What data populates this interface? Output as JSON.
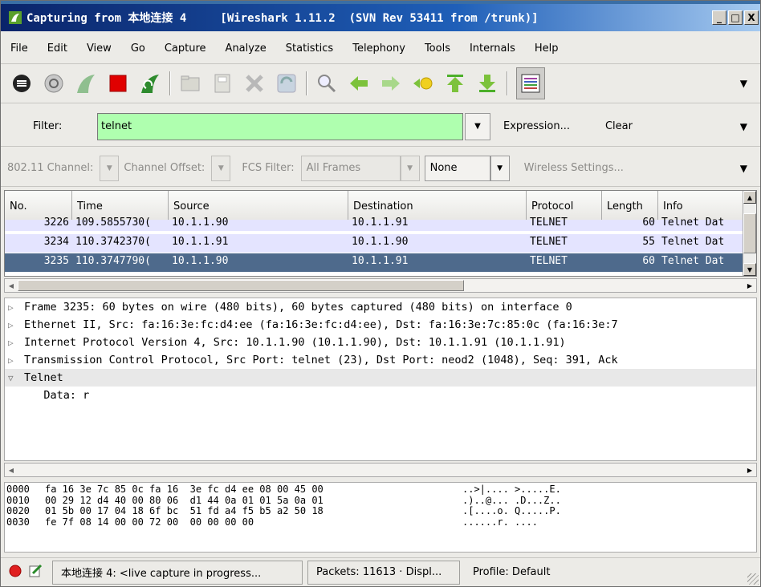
{
  "window": {
    "title": "Capturing from 本地连接 4     [Wireshark 1.11.2  (SVN Rev 53411 from /trunk)]",
    "minimize": "_",
    "maximize": "□",
    "close": "X"
  },
  "menu": [
    "File",
    "Edit",
    "View",
    "Go",
    "Capture",
    "Analyze",
    "Statistics",
    "Telephony",
    "Tools",
    "Internals",
    "Help"
  ],
  "filter": {
    "label": "Filter:",
    "value": "telnet",
    "expression": "Expression...",
    "clear": "Clear"
  },
  "wireless": {
    "channel_label": "802.11 Channel:",
    "offset_label": "Channel Offset:",
    "fcs_label": "FCS Filter:",
    "fcs_value": "All Frames",
    "decrypt_value": "None",
    "settings": "Wireless Settings..."
  },
  "packet_list": {
    "columns": [
      "No.",
      "Time",
      "Source",
      "Destination",
      "Protocol",
      "Length",
      "Info"
    ],
    "rows": [
      {
        "no": "3226",
        "time": "109.5855730(",
        "src": "10.1.1.90",
        "dst": "10.1.1.91",
        "proto": "TELNET",
        "len": "60",
        "info": "Telnet Dat"
      },
      {
        "no": "3234",
        "time": "110.3742370(",
        "src": "10.1.1.91",
        "dst": "10.1.1.90",
        "proto": "TELNET",
        "len": "55",
        "info": "Telnet Dat"
      },
      {
        "no": "3235",
        "time": "110.3747790(",
        "src": "10.1.1.90",
        "dst": "10.1.1.91",
        "proto": "TELNET",
        "len": "60",
        "info": "Telnet Dat"
      }
    ]
  },
  "details": [
    {
      "arrow": "▷",
      "text": "Frame 3235: 60 bytes on wire (480 bits), 60 bytes captured (480 bits) on interface 0"
    },
    {
      "arrow": "▷",
      "text": "Ethernet II, Src: fa:16:3e:fc:d4:ee (fa:16:3e:fc:d4:ee), Dst: fa:16:3e:7c:85:0c (fa:16:3e:7"
    },
    {
      "arrow": "▷",
      "text": "Internet Protocol Version 4, Src: 10.1.1.90 (10.1.1.90), Dst: 10.1.1.91 (10.1.1.91)"
    },
    {
      "arrow": "▷",
      "text": "Transmission Control Protocol, Src Port: telnet (23), Dst Port: neod2 (1048), Seq: 391, Ack"
    },
    {
      "arrow": "▽",
      "text": "Telnet"
    },
    {
      "arrow": "",
      "text": "   Data: r"
    }
  ],
  "hex": [
    {
      "off": "0000",
      "bytes": "fa 16 3e 7c 85 0c fa 16  3e fc d4 ee 08 00 45 00",
      "ascii": "..>|.... >.....E."
    },
    {
      "off": "0010",
      "bytes": "00 29 12 d4 40 00 80 06  d1 44 0a 01 01 5a 0a 01",
      "ascii": ".)..@... .D...Z.."
    },
    {
      "off": "0020",
      "bytes": "01 5b 00 17 04 18 6f bc  51 fd a4 f5 b5 a2 50 18",
      "ascii": ".[....o. Q.....P."
    },
    {
      "off": "0030",
      "bytes": "fe 7f 08 14 00 00 72 00  00 00 00 00",
      "ascii": "......r. ...."
    }
  ],
  "status": {
    "capture": "本地连接 4: <live capture in progress...",
    "packets": "Packets: 11613 · Displ...",
    "profile": "Profile: Default"
  },
  "colors": {
    "filter_ok": "#afffaf",
    "row_bg": "#e4e4ff",
    "row_selected": "#4e6a8c"
  }
}
